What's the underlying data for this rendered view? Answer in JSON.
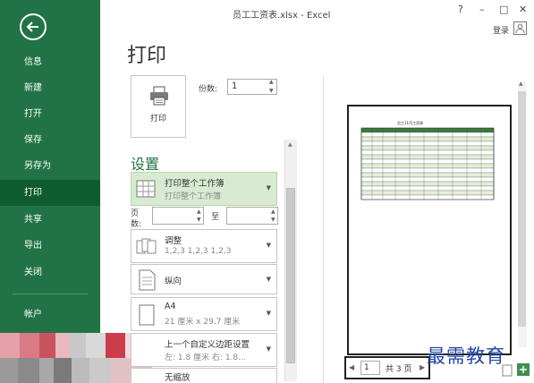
{
  "window": {
    "title": "员工工资表.xlsx - Excel",
    "help": "?",
    "minimize": "–",
    "maximize": "□",
    "close": "✕",
    "signin": "登录"
  },
  "sidebar": {
    "items": [
      {
        "label": "信息",
        "active": false
      },
      {
        "label": "新建",
        "active": false
      },
      {
        "label": "打开",
        "active": false
      },
      {
        "label": "保存",
        "active": false
      },
      {
        "label": "另存为",
        "active": false
      },
      {
        "label": "打印",
        "active": true
      },
      {
        "label": "共享",
        "active": false
      },
      {
        "label": "导出",
        "active": false
      },
      {
        "label": "关闭",
        "active": false
      }
    ],
    "account": "帐户"
  },
  "print": {
    "title": "打印",
    "button_label": "打印",
    "copies_label": "份数:",
    "copies_value": "1"
  },
  "settings": {
    "title": "设置",
    "what_to_print": {
      "title": "打印整个工作簿",
      "sub": "打印整个工作簿"
    },
    "pages_label_1": "页",
    "pages_label_2": "数:",
    "to_label": "至",
    "collate": {
      "title": "调整",
      "sub": "1,2,3    1,2,3    1,2,3"
    },
    "orientation": {
      "title": "纵向"
    },
    "paper": {
      "title": "A4",
      "sub": "21 厘米 x 29.7 厘米"
    },
    "margins": {
      "title": "上一个自定义边距设置",
      "sub": "左: 1.8 厘米    右: 1.8..."
    },
    "scaling": {
      "title": "无缩放"
    }
  },
  "preview": {
    "page_current": "1",
    "page_total": "共 3 页",
    "sheet_title": "员工11月工资表"
  },
  "watermark": "最需教育",
  "colors": {
    "sidebar": "#217346",
    "active": "#0f5c2e",
    "selected": "#d8ebd2",
    "accent": "#217346"
  }
}
